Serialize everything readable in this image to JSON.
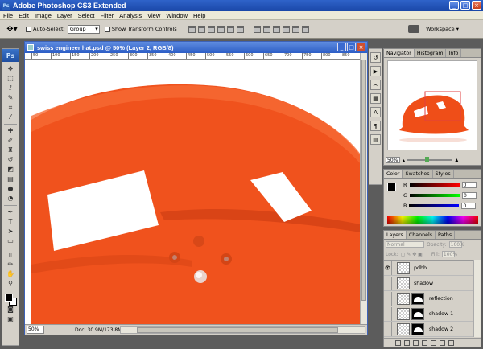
{
  "window": {
    "title": "Adobe Photoshop CS3 Extended",
    "badge": "Ps"
  },
  "window_controls": {
    "minimize": "_",
    "maximize": "□",
    "close": "×"
  },
  "menu": [
    "File",
    "Edit",
    "Image",
    "Layer",
    "Select",
    "Filter",
    "Analysis",
    "View",
    "Window",
    "Help"
  ],
  "options_bar": {
    "auto_select_label": "Auto-Select:",
    "auto_select_value": "Group",
    "show_transform_label": "Show Transform Controls",
    "workspace_label": "Workspace ▾"
  },
  "toolbox": {
    "logo": "Ps",
    "tools": [
      "move",
      "marquee",
      "lasso",
      "quick-select",
      "crop",
      "slice",
      "healing",
      "brush",
      "clone-stamp",
      "history-brush",
      "eraser",
      "gradient",
      "blur",
      "dodge",
      "pen",
      "type",
      "path-select",
      "shape",
      "notes",
      "eyedropper",
      "hand",
      "zoom"
    ]
  },
  "document": {
    "title": "swiss engineer hat.psd @ 50% (Layer 2, RGB/8)",
    "ruler_ticks": [
      "50",
      "100",
      "150",
      "200",
      "250",
      "300",
      "350",
      "400",
      "450",
      "500",
      "550",
      "600",
      "650",
      "700",
      "750",
      "800",
      "850"
    ],
    "zoom": "50%",
    "doc_info": "Doc: 30.9M/173.8M",
    "colors": {
      "hat": "#f0521d",
      "hat_shadow": "#c93c12",
      "background": "#ffffff"
    }
  },
  "icon_panel": [
    "history-icon",
    "actions-icon",
    "tools-preset-icon",
    "layer-comps-icon",
    "character-icon",
    "paragraph-icon",
    "clone-source-icon"
  ],
  "navigator": {
    "tabs": [
      "Navigator",
      "Histogram",
      "Info"
    ],
    "zoom": "50%"
  },
  "color_panel": {
    "tabs": [
      "Color",
      "Swatches",
      "Styles"
    ],
    "channels": [
      {
        "label": "R",
        "value": "0",
        "bar": "linear-gradient(90deg,#000,#f00)"
      },
      {
        "label": "G",
        "value": "0",
        "bar": "linear-gradient(90deg,#000,#0f0)"
      },
      {
        "label": "B",
        "value": "0",
        "bar": "linear-gradient(90deg,#000,#00f)"
      }
    ]
  },
  "layers_panel": {
    "tabs": [
      "Layers",
      "Channels",
      "Paths"
    ],
    "blend_mode": "Normal",
    "opacity_label": "Opacity:",
    "opacity_value": "100%",
    "lock_label": "Lock:",
    "fill_label": "Fill:",
    "fill_value": "100%",
    "layers": [
      {
        "name": "pdbb",
        "visible": true,
        "mask": false
      },
      {
        "name": "shadow",
        "visible": false,
        "mask": false
      },
      {
        "name": "reflection",
        "visible": false,
        "mask": true
      },
      {
        "name": "shadow 1",
        "visible": false,
        "mask": true
      },
      {
        "name": "shadow 2",
        "visible": false,
        "mask": true
      }
    ]
  }
}
